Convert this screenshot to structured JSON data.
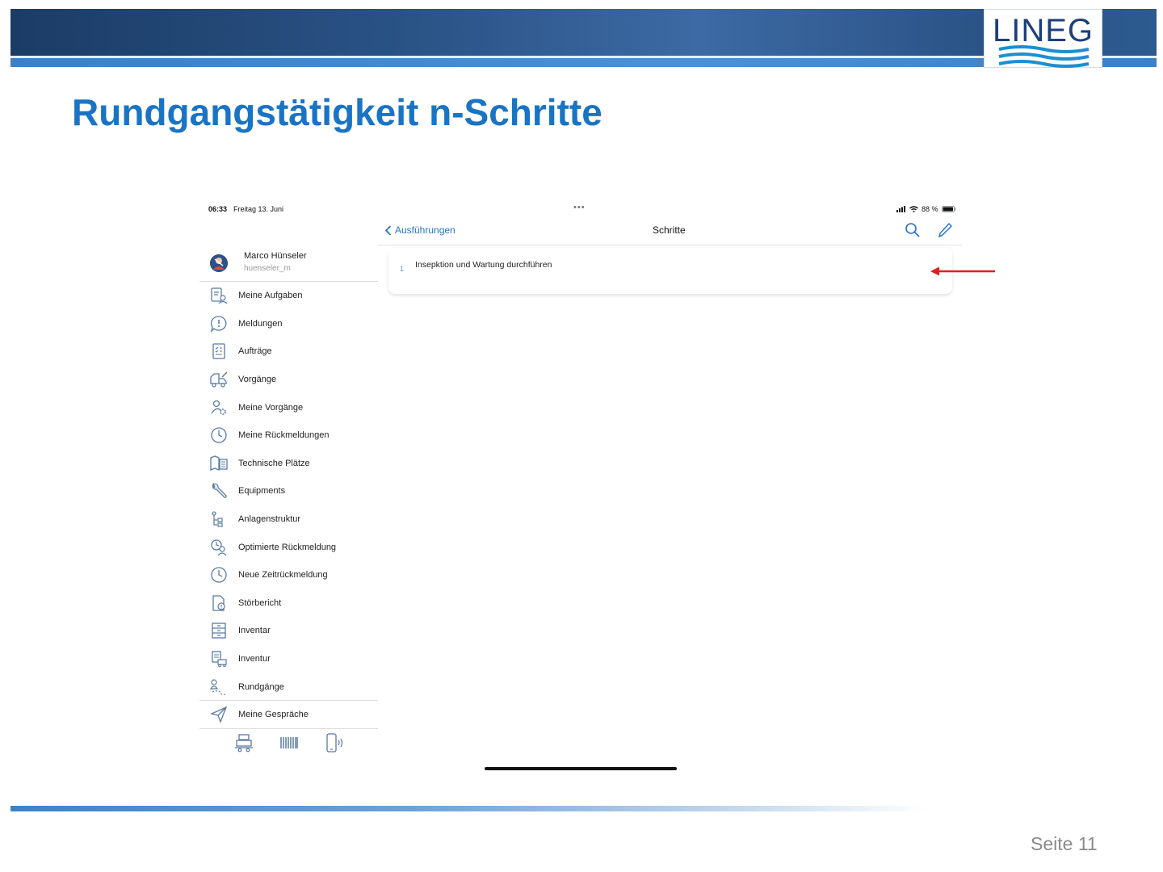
{
  "slide": {
    "title": "Rundgangstätigkeit n-Schritte",
    "logo": "LINEG",
    "page_label": "Seite 11"
  },
  "status_bar": {
    "time": "06:33",
    "date": "Freitag 13. Juni",
    "battery": "88 %"
  },
  "nav": {
    "back_label": "Ausführungen",
    "title": "Schritte"
  },
  "steps": [
    {
      "number": "1",
      "label": "Insepktion und Wartung durchführen"
    }
  ],
  "profile": {
    "name": "Marco Hünseler",
    "username": "huenseler_m"
  },
  "menu": [
    {
      "label": "Meine Aufgaben",
      "icon": "tasks-icon"
    },
    {
      "label": "Meldungen",
      "icon": "alert-bubble-icon"
    },
    {
      "label": "Aufträge",
      "icon": "checklist-icon"
    },
    {
      "label": "Vorgänge",
      "icon": "truck-edit-icon"
    },
    {
      "label": "Meine Vorgänge",
      "icon": "person-gear-icon"
    },
    {
      "label": "Meine Rückmeldungen",
      "icon": "clock-icon"
    },
    {
      "label": "Technische Plätze",
      "icon": "map-building-icon"
    },
    {
      "label": "Equipments",
      "icon": "wrench-icon"
    },
    {
      "label": "Anlagenstruktur",
      "icon": "hierarchy-icon"
    },
    {
      "label": "Optimierte Rückmeldung",
      "icon": "clock-person-icon"
    },
    {
      "label": "Neue Zeitrückmeldung",
      "icon": "clock-icon"
    },
    {
      "label": "Störbericht",
      "icon": "document-alert-icon"
    },
    {
      "label": "Inventar",
      "icon": "cabinet-icon"
    },
    {
      "label": "Inventur",
      "icon": "inventory-truck-icon"
    },
    {
      "label": "Rundgänge",
      "icon": "route-person-icon"
    }
  ],
  "extra_menu": {
    "label": "Meine Gespräche",
    "icon": "send-icon"
  },
  "bottom_bar": [
    "cart-icon",
    "barcode-icon",
    "nfc-phone-icon"
  ],
  "colors": {
    "accent": "#2574c3",
    "title": "#1a74c4",
    "arrow": "#e02020"
  }
}
